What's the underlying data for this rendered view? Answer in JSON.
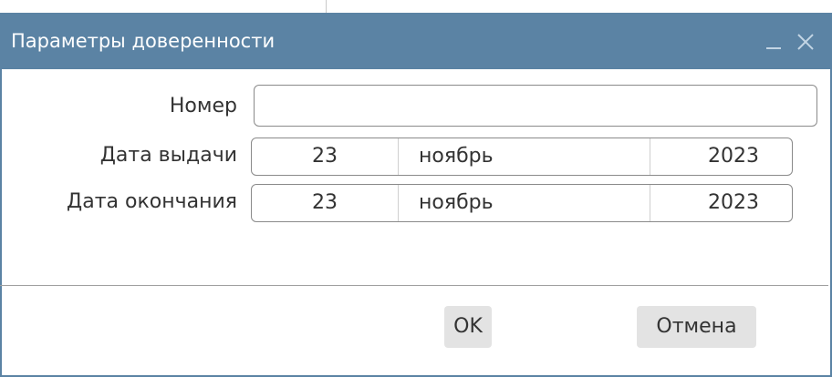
{
  "dialog": {
    "title": "Параметры доверенности",
    "window_controls": {
      "minimize_icon": "minimize-icon",
      "close_icon": "close-icon"
    }
  },
  "form": {
    "number": {
      "label": "Номер",
      "value": ""
    },
    "issue_date": {
      "label": "Дата выдачи",
      "day": "23",
      "month": "ноябрь",
      "year": "2023"
    },
    "end_date": {
      "label": "Дата окончания",
      "day": "23",
      "month": "ноябрь",
      "year": "2023"
    }
  },
  "buttons": {
    "ok_label": "OK",
    "cancel_label": "Отмена"
  },
  "colors": {
    "titlebar": "#5b83a4",
    "button_bg": "#e3e3e3"
  }
}
